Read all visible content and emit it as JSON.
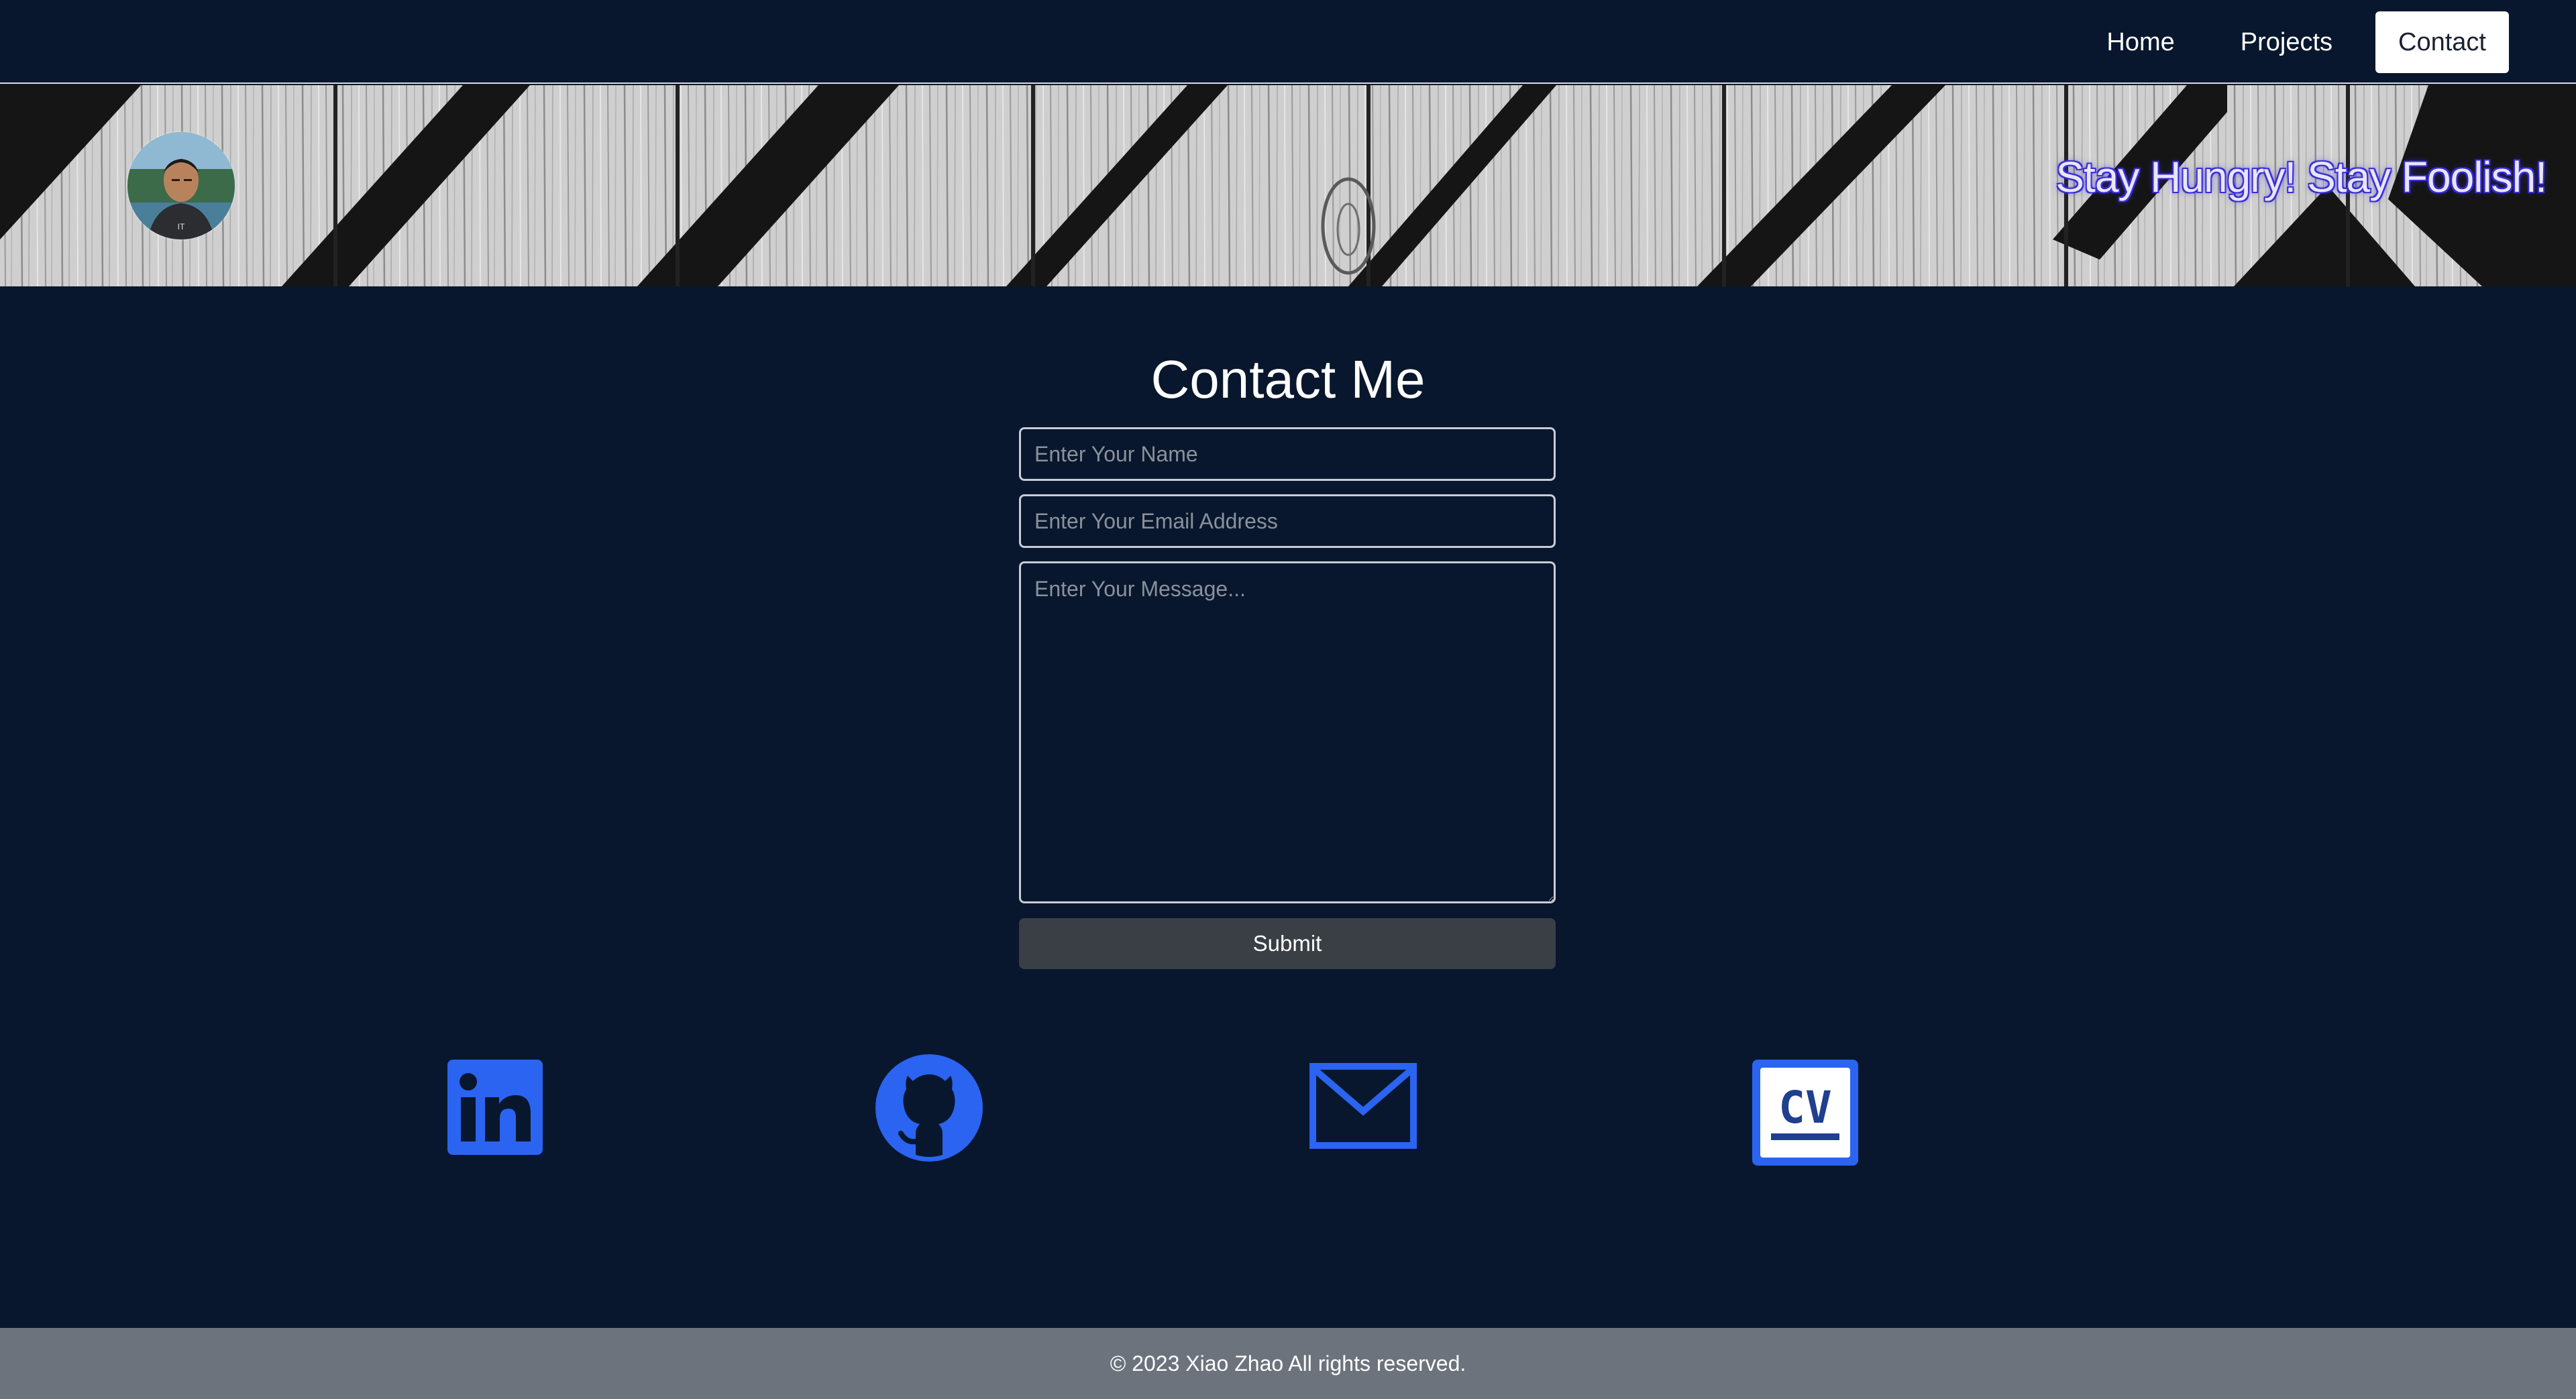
{
  "nav": {
    "links": [
      {
        "label": "Home"
      },
      {
        "label": "Projects"
      },
      {
        "label": "Contact",
        "active": true
      }
    ]
  },
  "banner": {
    "tagline": "Stay Hungry! Stay Foolish!",
    "avatar_icon": "profile-photo"
  },
  "contact": {
    "title": "Contact Me",
    "name_placeholder": "Enter Your Name",
    "email_placeholder": "Enter Your Email Address",
    "message_placeholder": "Enter Your Message...",
    "submit_label": "Submit"
  },
  "social": [
    {
      "name": "linkedin-icon"
    },
    {
      "name": "github-icon"
    },
    {
      "name": "email-icon"
    },
    {
      "name": "cv-icon",
      "text": "CV"
    }
  ],
  "footer": {
    "text": "© 2023 Xiao Zhao All rights reserved."
  },
  "colors": {
    "background": "#08172d",
    "accent": "#2a64f0",
    "footer": "#6c737c",
    "submit": "#3a3f45"
  }
}
